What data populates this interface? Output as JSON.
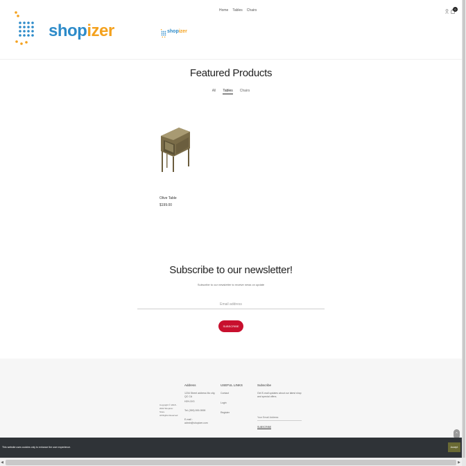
{
  "brand": {
    "shop": "shop",
    "izer": "izer",
    "accent_blue": "#2d8bc9",
    "accent_orange": "#f4a11d"
  },
  "nav": {
    "items": [
      "Home",
      "Tables",
      "Chairs"
    ]
  },
  "header_icons": {
    "user": "user-icon",
    "cart": "cart-icon",
    "cart_count": "0"
  },
  "featured": {
    "title": "Featured Products",
    "tabs": [
      "All",
      "Tables",
      "Chairs"
    ],
    "active_tab": "Tables",
    "products": [
      {
        "name": "Olive Table",
        "price": "$199.00"
      }
    ]
  },
  "newsletter": {
    "title": "Subscribe to our newsletter!",
    "subtitle": "Subscribe to our newsletter to receive news on update",
    "placeholder": "Email address",
    "button": "SUBSCRIBE",
    "button_color": "#c8102e"
  },
  "footer": {
    "copyright": [
      "Copyright © 2018 - 2022 Shopizer.",
      "Store.",
      "All Rights Reserved"
    ],
    "address": {
      "heading": "Address",
      "lines": [
        "1234 Street address Mo city, QC CA",
        "H2H-3X3",
        "Tel: (999) 999-9999",
        "E-mail : admin@shopizer.com"
      ]
    },
    "links": {
      "heading": "USEFUL LINKS",
      "items": [
        "Contact",
        "Login",
        "Register"
      ]
    },
    "subscribe": {
      "heading": "Subscribe",
      "text": "Get E-mail updates about our latest shop and special offers.",
      "placeholder": "Your Email Address",
      "button": "SUBSCRIBE"
    }
  },
  "scroll_top": "^",
  "cookie": {
    "text": "This website uses cookies only to enhance the user experience.",
    "button": "Accept"
  }
}
